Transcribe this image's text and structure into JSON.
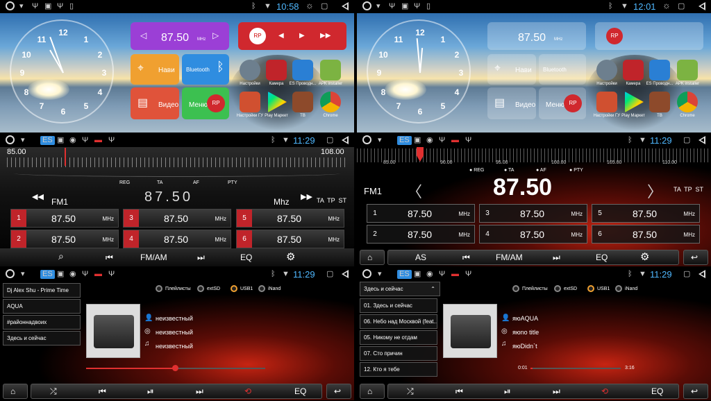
{
  "panel1": {
    "time": "10:58",
    "clock_numbers": [
      "12",
      "1",
      "2",
      "3",
      "4",
      "5",
      "6",
      "7",
      "8",
      "9",
      "10",
      "11"
    ],
    "radio_freq": "87.50",
    "radio_unit": "MHz",
    "navi": "Нави",
    "bluetooth": "Bluetooth",
    "video": "Видео",
    "menu": "Меню",
    "apps": [
      "Настройки",
      "Камера",
      "ES Проводн...",
      "APK installer",
      "Настройки ГУ",
      "Play Маркет",
      "TB",
      "Chrome"
    ]
  },
  "panel2": {
    "time": "12:01",
    "radio_freq": "87.50",
    "radio_unit": "MHz",
    "navi": "Нави",
    "bluetooth": "Bluetooth",
    "video": "Видео",
    "menu": "Меню",
    "apps": [
      "Настройки",
      "Камера",
      "ES Проводн...",
      "APK installer",
      "Настройки ГУ",
      "Play Маркет",
      "TB",
      "Chrome"
    ]
  },
  "panel3": {
    "time": "11:29",
    "scale_min": "85.00",
    "scale_max": "108.00",
    "flags": [
      "REG",
      "TA",
      "AF",
      "PTY"
    ],
    "band": "FM1",
    "freq": "87.50",
    "unit": "Mhz",
    "tatp": "TA  TP  ST",
    "presets": [
      {
        "n": "1",
        "f": "87.50"
      },
      {
        "n": "3",
        "f": "87.50"
      },
      {
        "n": "5",
        "f": "87.50"
      },
      {
        "n": "2",
        "f": "87.50"
      },
      {
        "n": "4",
        "f": "87.50"
      },
      {
        "n": "6",
        "f": "87.50"
      }
    ],
    "preset_unit": "MHz",
    "fmam": "FM/AM",
    "eq": "EQ"
  },
  "panel4": {
    "time": "11:29",
    "ticks": [
      "85.00",
      "90.00",
      "95.00",
      "100.00",
      "105.00",
      "110.00"
    ],
    "flags": [
      "REG",
      "TA",
      "AF",
      "PTY"
    ],
    "band": "FM1",
    "freq": "87.50",
    "tatp": "TA  TP  ST",
    "presets": [
      {
        "n": "1",
        "f": "87.50"
      },
      {
        "n": "3",
        "f": "87.50"
      },
      {
        "n": "5",
        "f": "87.50"
      },
      {
        "n": "2",
        "f": "87.50"
      },
      {
        "n": "4",
        "f": "87.50"
      },
      {
        "n": "6",
        "f": "87.50"
      }
    ],
    "preset_unit": "MHz",
    "as": "AS",
    "fmam": "FM/AM",
    "eq": "EQ"
  },
  "panel5": {
    "time": "11:29",
    "list": [
      "Dj Alex Shu - Prime Time",
      "AQUA",
      "#районнадвоих",
      "Здесь и сейчас"
    ],
    "sources": [
      "Плейлисты",
      "extSD",
      "USB1",
      "iNand"
    ],
    "meta": [
      "неизвестный",
      "неизвестный",
      "неизвестный"
    ],
    "eq": "EQ"
  },
  "panel6": {
    "time": "11:29",
    "header": "Здесь и сейчас",
    "list": [
      "01. Здесь и сейчас",
      "06. Небо над Москвой (feat...",
      "05. Никому не отдам",
      "07. Сто причин",
      "12. Кто я тебе"
    ],
    "sources": [
      "Плейлисты",
      "extSD",
      "USB1",
      "iNand"
    ],
    "meta": [
      "яюAQUA",
      "яюno title",
      "яюDidn`t"
    ],
    "pos": "0:01",
    "dur": "3:16",
    "eq": "EQ"
  },
  "colors": {
    "status_time": "#4fb8ff",
    "accent_red": "#c0242a",
    "tile_purple": "#9b3fd6",
    "tile_orange": "#f0a030",
    "tile_blue": "#2f8de0",
    "tile_green": "#3cc050"
  }
}
